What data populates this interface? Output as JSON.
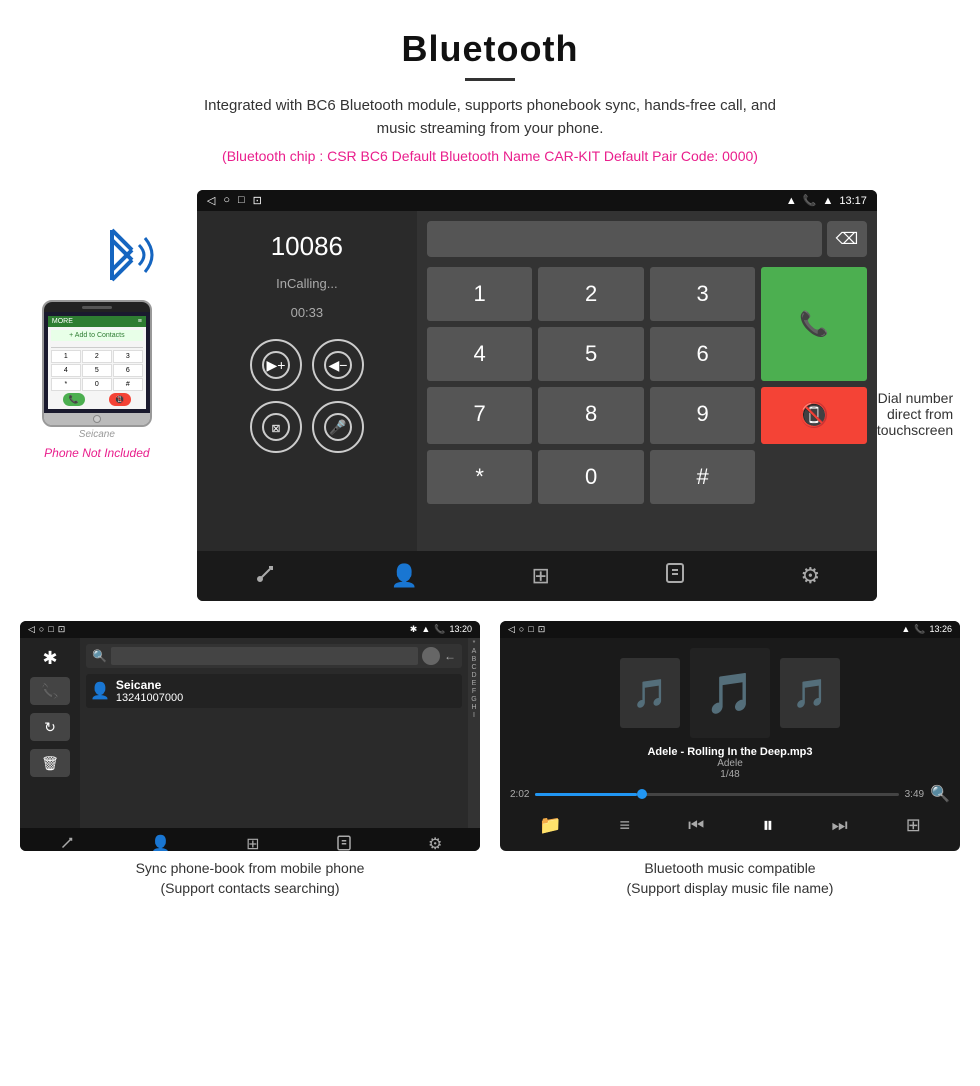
{
  "header": {
    "title": "Bluetooth",
    "description": "Integrated with BC6 Bluetooth module, supports phonebook sync, hands-free call, and music streaming from your phone.",
    "specs": "(Bluetooth chip : CSR BC6    Default Bluetooth Name CAR-KIT    Default Pair Code: 0000)"
  },
  "top_screen": {
    "status_bar": {
      "nav_icons": [
        "◁",
        "○",
        "□",
        "⊡"
      ],
      "right_icons": [
        "📍",
        "📞",
        "📶",
        "13:17"
      ]
    },
    "call_number": "10086",
    "call_status": "InCalling...",
    "call_time": "00:33",
    "keypad": {
      "keys": [
        "1",
        "2",
        "3",
        "*",
        "4",
        "5",
        "6",
        "0",
        "7",
        "8",
        "9",
        "#"
      ]
    },
    "bottom_icons": [
      "call-transfer",
      "contacts",
      "keypad",
      "call-log",
      "settings"
    ]
  },
  "top_caption": "Dial number direct from touchscreen",
  "phone_not_included": "Phone Not Included",
  "seicane_label": "Seicane",
  "bottom_left": {
    "screen": {
      "status_bar": {
        "left": [
          "◁",
          "○",
          "□",
          "⊡"
        ],
        "right": [
          "📍",
          "📞",
          "13:20"
        ]
      },
      "contact_name": "Seicane",
      "contact_number": "13241007000",
      "alphabet": [
        "*",
        "A",
        "B",
        "C",
        "D",
        "E",
        "F",
        "G",
        "H",
        "I"
      ],
      "search_icon": "🔍",
      "back_icon": "←",
      "bottom_icons": [
        "📞",
        "👤",
        "⊞",
        "📋",
        "⚙"
      ]
    },
    "caption_line1": "Sync phone-book from mobile phone",
    "caption_line2": "(Support contacts searching)"
  },
  "bottom_right": {
    "screen": {
      "status_bar": {
        "left": [
          "◁",
          "○",
          "□",
          "⊡"
        ],
        "right": [
          "📍",
          "📞",
          "13:26"
        ]
      },
      "track_name": "Adele - Rolling In the Deep.mp3",
      "artist": "Adele",
      "track_count": "1/48",
      "time_current": "2:02",
      "time_total": "3:49",
      "progress_percent": 28
    },
    "caption_line1": "Bluetooth music compatible",
    "caption_line2": "(Support display music file name)"
  }
}
